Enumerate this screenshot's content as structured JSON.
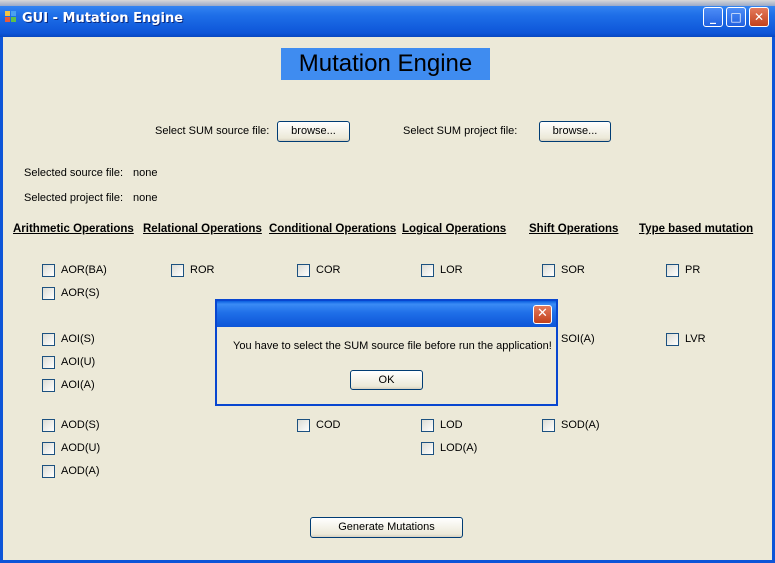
{
  "window": {
    "title": "GUI - Mutation Engine"
  },
  "heading": "Mutation Engine",
  "source_file": {
    "prompt": "Select SUM source file:",
    "button": "browse..."
  },
  "project_file": {
    "prompt": "Select SUM project file:",
    "button": "browse..."
  },
  "selected": {
    "source_label": "Selected source file:",
    "source_value": "none",
    "project_label": "Selected project file:",
    "project_value": "none"
  },
  "categories": {
    "arithmetic": "Arithmetic Operations",
    "relational": "Relational Operations",
    "conditional": "Conditional Operations",
    "logical": "Logical Operations",
    "shift": "Shift Operations",
    "type": "Type based mutation"
  },
  "checks": {
    "aor_ba": "AOR(BA)",
    "aor_s": "AOR(S)",
    "aoi_s": "AOI(S)",
    "aoi_u": "AOI(U)",
    "aoi_a": "AOI(A)",
    "aod_s": "AOD(S)",
    "aod_u": "AOD(U)",
    "aod_a": "AOD(A)",
    "ror": "ROR",
    "cor": "COR",
    "cod": "COD",
    "lor": "LOR",
    "lod": "LOD",
    "lod_a": "LOD(A)",
    "sor": "SOR",
    "soi_a": "SOI(A)",
    "sod_a": "SOD(A)",
    "pr": "PR",
    "lvr": "LVR"
  },
  "generate_button": "Generate Mutations",
  "dialog": {
    "message": "You have to select the SUM source file before run the application!",
    "ok": "OK"
  }
}
